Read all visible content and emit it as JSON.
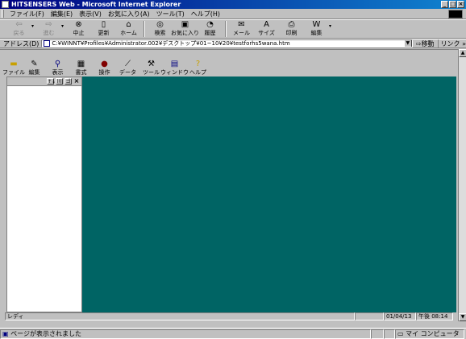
{
  "window": {
    "title": "HITSENSERS Web - Microsoft Internet Explorer",
    "controls": [
      "_",
      "□",
      "×"
    ]
  },
  "menu": [
    "ファイル(F)",
    "編集(E)",
    "表示(V)",
    "お気に入り(A)",
    "ツール(T)",
    "ヘルプ(H)"
  ],
  "toolbar": {
    "back": "戻る",
    "forward": "進む",
    "stop": "中止",
    "refresh": "更新",
    "home": "ホーム",
    "search": "検索",
    "favorites": "お気に入り",
    "history": "履歴",
    "mail": "メール",
    "size": "サイズ",
    "print": "印刷",
    "edit": "編集"
  },
  "address": {
    "label": "アドレス(D)",
    "url": "C:¥WINNT¥Profiles¥Administrator.002¥デスクトップ¥01~10¥20¥testforhs5wana.htm",
    "go": "移動",
    "links": "リンク »"
  },
  "app": {
    "toolbar": [
      "ファイル",
      "編集",
      "表示",
      "書式",
      "操作",
      "データ",
      "ツール",
      "ウィンドウ",
      "ヘルプ"
    ],
    "panel_buttons": [
      "↑↓",
      "川",
      "ゴ"
    ],
    "status_left": "レディ",
    "date": "01/04/13",
    "time": "午後 08:14",
    "colors": {
      "main_pane": "#006464"
    }
  },
  "status": {
    "text": "ページが表示されました",
    "zone": "マイ コンピュータ"
  }
}
